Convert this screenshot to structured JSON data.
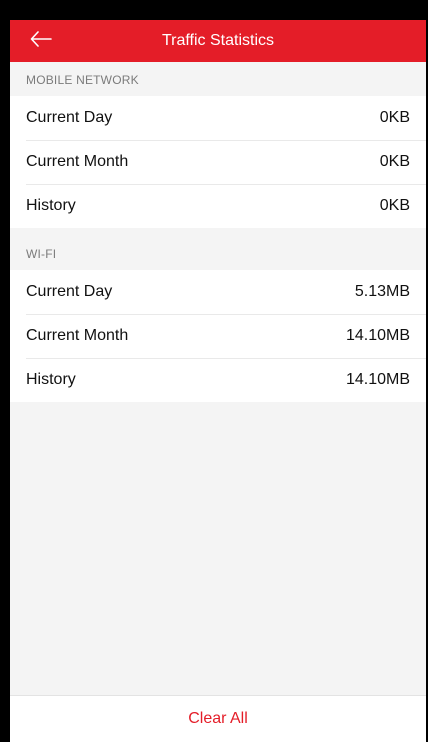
{
  "app": {
    "title": "Traffic Statistics",
    "accent_color": "#e41d28",
    "back_icon": "arrow-left-icon"
  },
  "sections": [
    {
      "header": "MOBILE NETWORK",
      "rows": [
        {
          "label": "Current Day",
          "value": "0KB"
        },
        {
          "label": "Current Month",
          "value": "0KB"
        },
        {
          "label": "History",
          "value": "0KB"
        }
      ]
    },
    {
      "header": "WI-FI",
      "rows": [
        {
          "label": "Current Day",
          "value": "5.13MB"
        },
        {
          "label": "Current Month",
          "value": "14.10MB"
        },
        {
          "label": "History",
          "value": "14.10MB"
        }
      ]
    }
  ],
  "footer": {
    "clear_label": "Clear All"
  }
}
